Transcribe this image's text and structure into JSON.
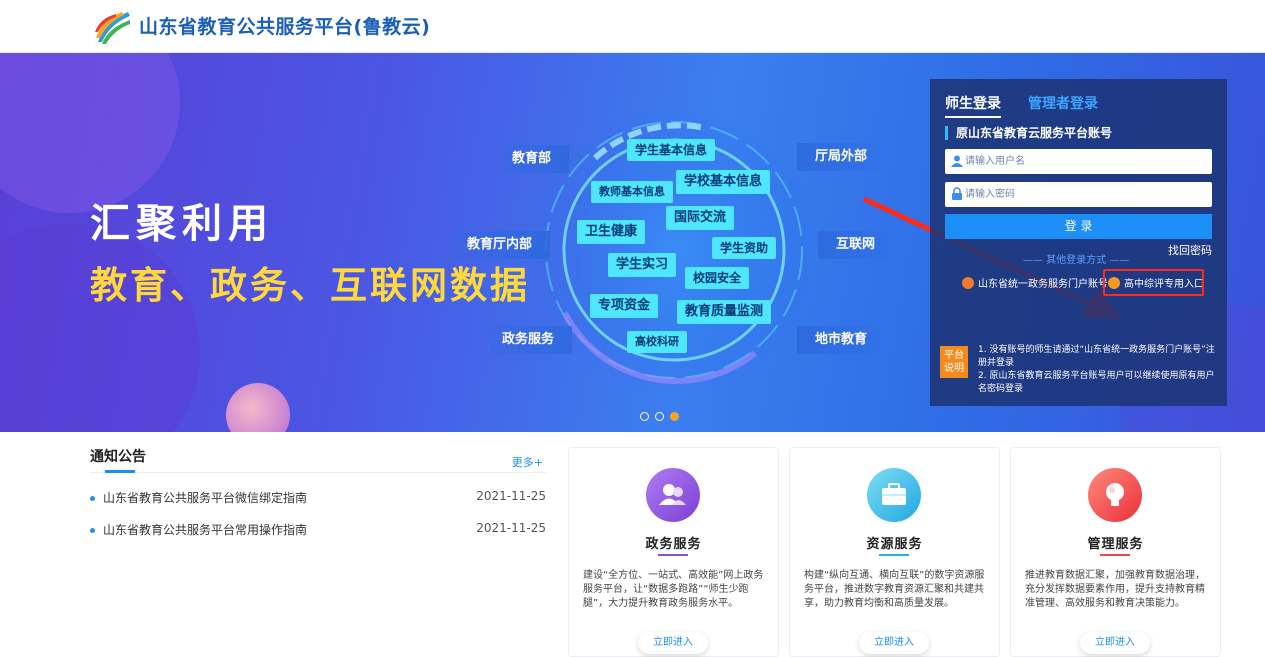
{
  "header": {
    "site_title": "山东省教育公共服务平台(鲁教云)"
  },
  "banner": {
    "slogan_line1": "汇聚利用",
    "slogan_line2": "教育、政务、互联网数据",
    "left_labels": [
      "教育部",
      "教育厅内部",
      "政务服务"
    ],
    "right_labels": [
      "厅局外部",
      "互联网",
      "地市教育"
    ],
    "tags": [
      "学生基本信息",
      "教师基本信息",
      "学校基本信息",
      "卫生健康",
      "国际交流",
      "学生资助",
      "学生实习",
      "校园安全",
      "专项资金",
      "教育质量监测",
      "高校科研"
    ],
    "carousel_active_index": 2
  },
  "login": {
    "tab_teacher": "师生登录",
    "tab_admin": "管理者登录",
    "account_title": "原山东省教育云服务平台账号",
    "username_placeholder": "请输入用户名",
    "password_placeholder": "请输入密码",
    "login_button": "登 录",
    "find_password": "找回密码",
    "other_ways": "—— 其他登录方式 ——",
    "gov_login": "山东省统一政务服务门户账号",
    "highschool_login": "高中综评专用入口",
    "note_badge": "平台说明",
    "note_1": "1. 没有账号的师生请通过“山东省统一政务服务门户账号”注册并登录",
    "note_2": "2. 原山东省教育云服务平台账号用户可以继续使用原有用户名密码登录"
  },
  "notice": {
    "title": "通知公告",
    "more": "更多+",
    "items": [
      {
        "title": "山东省教育公共服务平台微信绑定指南",
        "date": "2021-11-25"
      },
      {
        "title": "山东省教育公共服务平台常用操作指南",
        "date": "2021-11-25"
      }
    ]
  },
  "cards": [
    {
      "title": "政务服务",
      "desc": "建设“全方位、一站式、高效能”网上政务服务平台，让“数据多跑路”“师生少跑腿”，大力提升教育政务服务水平。",
      "button": "立即进入",
      "color": "#8a4de0"
    },
    {
      "title": "资源服务",
      "desc": "构建“纵向互通、横向互联”的数字资源服务平台，推进数字教育资源汇聚和共建共享，助力教育均衡和高质量发展。",
      "button": "立即进入",
      "color": "#1fb3e6"
    },
    {
      "title": "管理服务",
      "desc": "推进教育数据汇聚，加强教育数据治理，充分发挥数据要素作用，提升支持教育精准管理、高效服务和教育决策能力。",
      "button": "立即进入",
      "color": "#f0434a"
    }
  ],
  "colors": {
    "accent": "#1c8ef6",
    "slogan_yellow": "#ffd93b",
    "highlight_red": "#ff2a18"
  }
}
